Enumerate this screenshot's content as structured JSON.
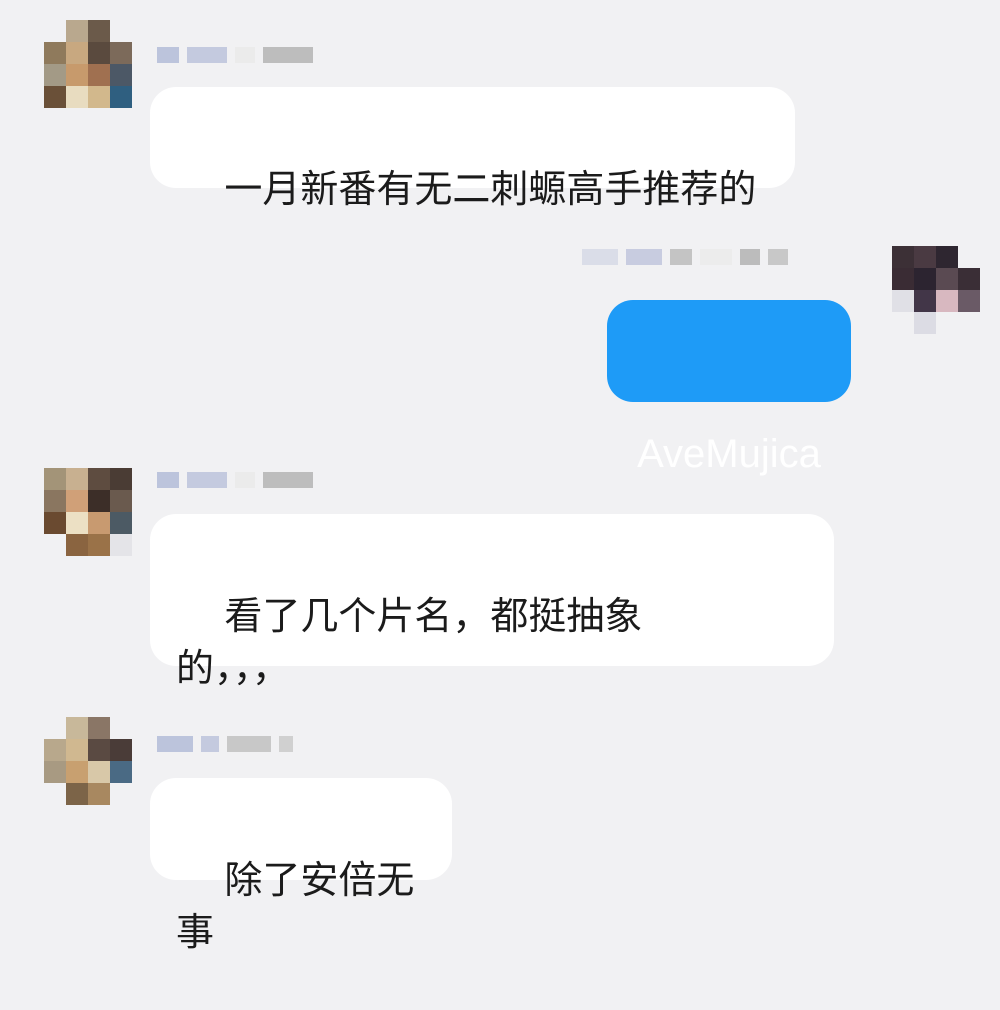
{
  "messages": [
    {
      "sender": "other",
      "text": "一月新番有无二刺螈高手推荐的"
    },
    {
      "sender": "me",
      "text": "AveMujica"
    },
    {
      "sender": "other",
      "text": "看了几个片名，都挺抽象\n的，，，"
    },
    {
      "sender": "other",
      "text": "除了安倍无事"
    }
  ],
  "colors": {
    "background": "#f1f1f3",
    "incoming_bubble": "#ffffff",
    "outgoing_bubble": "#1e9bf7"
  }
}
